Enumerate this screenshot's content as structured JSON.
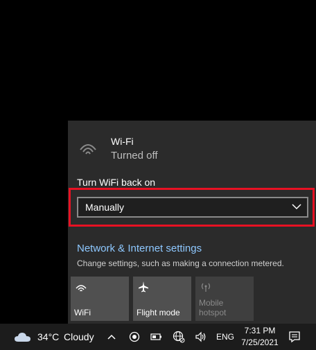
{
  "wifi": {
    "name": "Wi-Fi",
    "status": "Turned off",
    "icon": "wifi-icon"
  },
  "turn_on": {
    "label": "Turn WiFi back on",
    "selected": "Manually"
  },
  "network_settings": {
    "link": "Network & Internet settings",
    "description": "Change settings, such as making a connection metered."
  },
  "quick_actions": [
    {
      "label": "WiFi",
      "icon": "wifi-icon"
    },
    {
      "label": "Flight mode",
      "icon": "airplane-icon"
    },
    {
      "label": "Mobile hotspot",
      "icon": "hotspot-icon"
    }
  ],
  "taskbar": {
    "temperature": "34°C",
    "condition": "Cloudy",
    "language": "ENG",
    "time": "7:31 PM",
    "date": "7/25/2021"
  },
  "colors": {
    "accent_link": "#8ec8ff",
    "highlight": "#e81123",
    "panel": "#2b2b2b"
  }
}
